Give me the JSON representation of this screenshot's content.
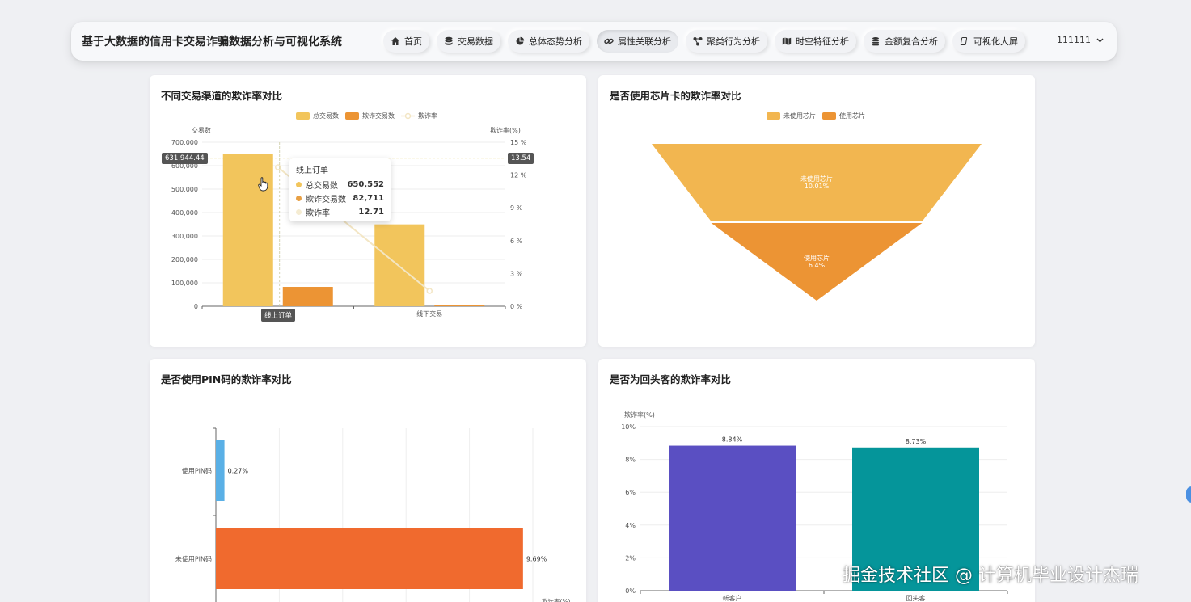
{
  "header": {
    "title": "基于大数据的信用卡交易诈骗数据分析与可视化系统",
    "nav": [
      {
        "label": "首页",
        "icon": "home-icon"
      },
      {
        "label": "交易数据",
        "icon": "database-icon"
      },
      {
        "label": "总体态势分析",
        "icon": "pie-chart-icon"
      },
      {
        "label": "属性关联分析",
        "icon": "link-icon",
        "active": true
      },
      {
        "label": "聚类行为分析",
        "icon": "cluster-icon"
      },
      {
        "label": "时空特征分析",
        "icon": "map-icon"
      },
      {
        "label": "金额复合分析",
        "icon": "coins-icon"
      },
      {
        "label": "可视化大屏",
        "icon": "screen-icon"
      }
    ],
    "user": "111111"
  },
  "cards": {
    "channel": {
      "title": "不同交易渠道的欺诈率对比"
    },
    "chip": {
      "title": "是否使用芯片卡的欺诈率对比"
    },
    "pin": {
      "title": "是否使用PIN码的欺诈率对比"
    },
    "repeat": {
      "title": "是否为回头客的欺诈率对比"
    }
  },
  "tooltip": {
    "title": "线上订单",
    "rows": [
      {
        "name": "总交易数",
        "value": "650,552",
        "color": "#f2c55c"
      },
      {
        "name": "欺诈交易数",
        "value": "82,711",
        "color": "#e8a045"
      },
      {
        "name": "欺诈率",
        "value": "12.71",
        "color": "#f5ecd2"
      }
    ]
  },
  "axis_pointer": {
    "left_value": "631,944.44",
    "right_value": "13.54",
    "category": "线上订单"
  },
  "watermark": "掘金技术社区 @ 计算机毕业设计杰瑞",
  "chart_data": [
    {
      "type": "bar",
      "title": "不同交易渠道的欺诈率对比",
      "categories": [
        "线上订单",
        "线下交易"
      ],
      "ylabel": "交易数",
      "y2label": "欺诈率(%)",
      "ylim": [
        0,
        700000
      ],
      "y2lim": [
        0,
        15
      ],
      "yticks": [
        "0",
        "100,000",
        "200,000",
        "300,000",
        "400,000",
        "500,000",
        "600,000",
        "700,000"
      ],
      "y2ticks": [
        "0 %",
        "3 %",
        "6 %",
        "9 %",
        "12 %",
        "15 %"
      ],
      "legend": [
        "总交易数",
        "欺诈交易数",
        "欺诈率"
      ],
      "series": [
        {
          "name": "总交易数",
          "kind": "bar",
          "color": "#f2c55c",
          "values": [
            650552,
            349448
          ]
        },
        {
          "name": "欺诈交易数",
          "kind": "bar",
          "color": "#ec9434",
          "values": [
            82711,
            5000
          ]
        },
        {
          "name": "欺诈率",
          "kind": "line",
          "color": "#f3e6c4",
          "values": [
            12.71,
            1.4
          ]
        }
      ]
    },
    {
      "type": "funnel",
      "title": "是否使用芯片卡的欺诈率对比",
      "legend": [
        "未使用芯片",
        "使用芯片"
      ],
      "series": [
        {
          "name": "未使用芯片",
          "value": 10.01,
          "label": "10.01%",
          "color": "#f2b650"
        },
        {
          "name": "使用芯片",
          "value": 6.4,
          "label": "6.4%",
          "color": "#ec9434"
        }
      ]
    },
    {
      "type": "bar",
      "orientation": "horizontal",
      "title": "是否使用PIN码的欺诈率对比",
      "categories": [
        "使用PIN码",
        "未使用PIN码"
      ],
      "xlabel": "欺诈率(%)",
      "xlim": [
        0,
        10
      ],
      "values": [
        0.27,
        9.69
      ],
      "labels": [
        "0.27%",
        "9.69%"
      ],
      "colors": [
        "#5ab0e6",
        "#f06a2e"
      ]
    },
    {
      "type": "bar",
      "title": "是否为回头客的欺诈率对比",
      "categories": [
        "新客户",
        "回头客"
      ],
      "ylabel": "欺诈率(%)",
      "ylim": [
        0,
        10
      ],
      "yticks": [
        "0%",
        "2%",
        "4%",
        "6%",
        "8%",
        "10%"
      ],
      "values": [
        8.84,
        8.73
      ],
      "labels": [
        "8.84%",
        "8.73%"
      ],
      "colors": [
        "#5a4fc2",
        "#05959a"
      ]
    }
  ]
}
